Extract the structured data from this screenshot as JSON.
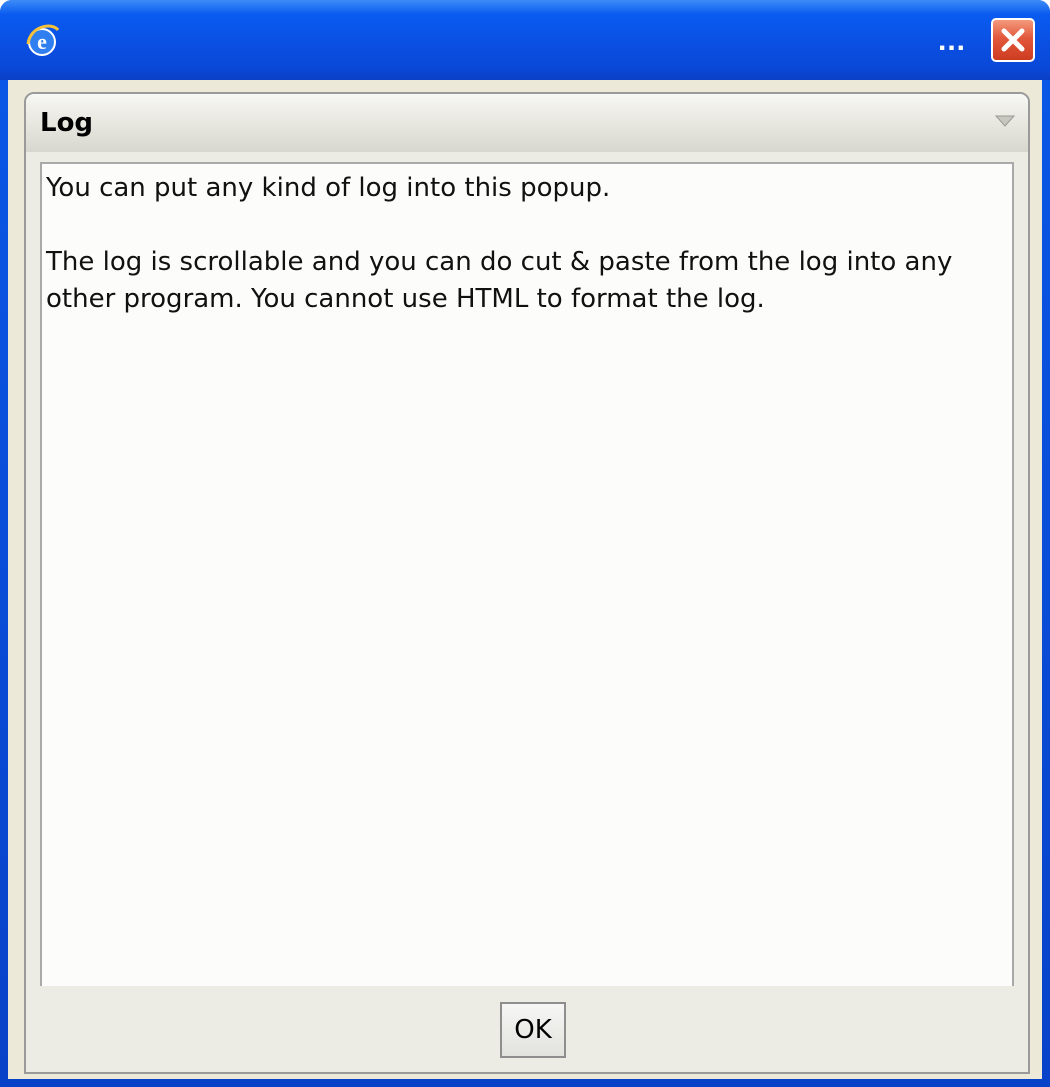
{
  "window": {
    "title": "...",
    "icon": "ie-icon",
    "close_icon": "close-icon"
  },
  "panel": {
    "title": "Log",
    "collapse_icon": "triangle-down-icon"
  },
  "log": {
    "text": "You can put any kind of log into this popup.\n\nThe log is scrollable and you can do cut & paste from the log into any other program. You cannot use HTML to format the log."
  },
  "footer": {
    "ok_label": "OK"
  },
  "colors": {
    "titlebar": "#0a4ee0",
    "close": "#e2583c",
    "panel_bg": "#ecebe4"
  }
}
